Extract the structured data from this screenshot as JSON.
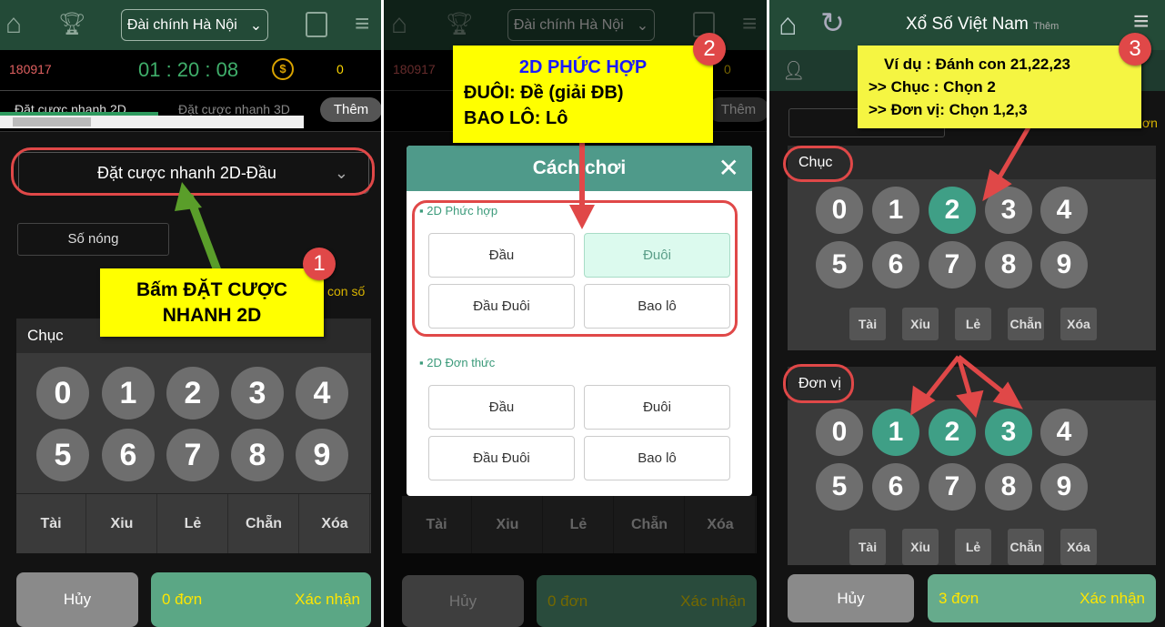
{
  "header": {
    "station": "Đài chính Hà Nội",
    "title": "Xổ Số Việt Nam",
    "title_more": "Thêm"
  },
  "info": {
    "draw_id": "180917",
    "countdown": "01 : 20 : 08",
    "coins": "0"
  },
  "tabs": [
    {
      "label": "Đặt cược nhanh 2D"
    },
    {
      "label": "Đặt cược nhanh 3D"
    }
  ],
  "more_label": "Thêm",
  "bet_dropdown": "Đặt cược nhanh 2D-Đầu",
  "hot_numbers": "Số nóng",
  "hint_partial": "con số",
  "sections": {
    "tens": "Chục",
    "units": "Đơn vị"
  },
  "digits": [
    "0",
    "1",
    "2",
    "3",
    "4",
    "5",
    "6",
    "7",
    "8",
    "9"
  ],
  "quick": [
    "Tài",
    "Xỉu",
    "Lẻ",
    "Chẵn",
    "Xóa"
  ],
  "quick_panel1": [
    "Tài",
    "Xiu",
    "Lẻ",
    "Chẵn",
    "Xóa"
  ],
  "panel3": {
    "tens_selected": [
      2
    ],
    "units_selected": [
      1,
      2,
      3
    ],
    "partial_btn": "Số",
    "partial_text": "ơn"
  },
  "footer": {
    "cancel": "Hủy",
    "count1": "0 đơn",
    "count3": "3 đơn",
    "confirm": "Xác nhận"
  },
  "modal": {
    "title": "Cách chơi",
    "group1": "2D Phức hợp",
    "group2": "2D Đơn thức",
    "options": [
      "Đầu",
      "Đuôi",
      "Đầu Đuôi",
      "Bao lô"
    ],
    "selected": "Đuôi"
  },
  "callouts": {
    "c1": {
      "num": "1",
      "line1": "Bấm ĐẶT CƯỢC",
      "line2": "NHANH 2D"
    },
    "c2": {
      "num": "2",
      "title": "2D PHỨC HỢP",
      "line1": "ĐUÔI: Đề (giải ĐB)",
      "line2": "BAO LÔ: Lô"
    },
    "c3": {
      "num": "3",
      "line1": "Ví dụ : Đánh con 21,22,23",
      "line2": ">> Chục : Chọn 2",
      "line3": ">> Đơn vị: Chọn 1,2,3"
    }
  },
  "colors": {
    "header": "#234a37",
    "accent": "#3f9f86",
    "callout": "#ffff00",
    "annotation": "#e04848",
    "confirm": "#5ba785"
  }
}
